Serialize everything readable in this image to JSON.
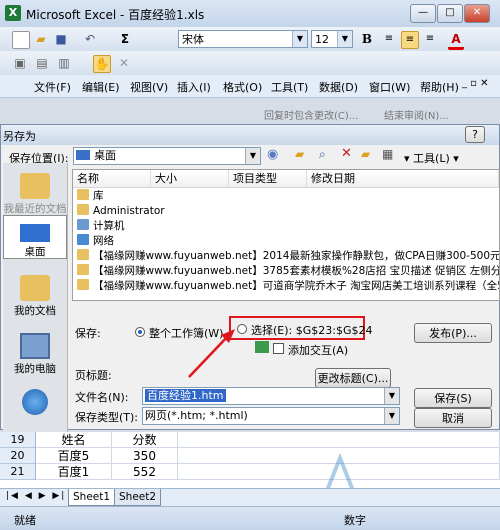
{
  "excel": {
    "title": "Microsoft Excel - 百度经验1.xls",
    "icon_label": "X",
    "toolbar": {
      "sigma": "Σ",
      "font_name": "宋体",
      "font_size": "12",
      "bold": "B",
      "font_color_glyph": "A",
      "reply_text": "回复时包含更改(C)...",
      "end_review": "结束审阅(N)..."
    },
    "menu": [
      "文件(F)",
      "编辑(E)",
      "视图(V)",
      "插入(I)",
      "格式(O)",
      "工具(T)",
      "数据(D)",
      "窗口(W)",
      "帮助(H)"
    ]
  },
  "dialog": {
    "title": "另存为",
    "save_in_label": "保存位置(I):",
    "save_in_value": "桌面",
    "tools_label": "工具(L)",
    "columns": [
      "名称",
      "大小",
      "项目类型",
      "修改日期"
    ],
    "places": [
      "我最近的文档",
      "桌面",
      "我的文档",
      "我的电脑",
      "网上邻居"
    ],
    "files": [
      {
        "name": "库",
        "color": "#e8c060"
      },
      {
        "name": "Administrator",
        "color": "#e8c060"
      },
      {
        "name": "计算机",
        "color": "#6a9ad0"
      },
      {
        "name": "网络",
        "color": "#4a8ad0"
      },
      {
        "name": "【福缘网赚www.fuyuanweb.net】2014最新独家操作静默包，做CPA日赚300-500元%2",
        "color": "#e8c060"
      },
      {
        "name": "【福缘网赚www.fuyuanweb.net】3785套素材模板%28店招 宝贝描述 促销区 左侧分类轮",
        "color": "#e8c060"
      },
      {
        "name": "【福缘网赚www.fuyuanweb.net】可道商学院乔木子 淘宝网店美工培训系列课程（全5部",
        "color": "#e8c060"
      }
    ],
    "save_label": "保存:",
    "whole_workbook": "整个工作簿(W)",
    "selection": "选择(E): $G$23:$G$24",
    "add_interaction": "添加交互(A)",
    "publish_button": "发布(P)...",
    "page_title_label": "页标题:",
    "change_title_button": "更改标题(C)...",
    "filename_label": "文件名(N):",
    "filename_value": "百度经验1.htm",
    "filetype_label": "保存类型(T):",
    "filetype_value": "网页(*.htm; *.html)",
    "save_button": "保存(S)",
    "cancel_button": "取消"
  },
  "sheet": {
    "rows": [
      {
        "num": "19",
        "a": "姓名",
        "b": "分数"
      },
      {
        "num": "20",
        "a": "百度5",
        "b": "350"
      },
      {
        "num": "21",
        "a": "百度1",
        "b": "552"
      }
    ],
    "tabs": [
      "Sheet1",
      "Sheet2"
    ],
    "status_left": "就绪",
    "status_right": "数字"
  },
  "watermark": "我爱IT技术网 www.52ij.com",
  "colors": {
    "highlight": "#e0161c",
    "accent": "#1a5fc0"
  }
}
